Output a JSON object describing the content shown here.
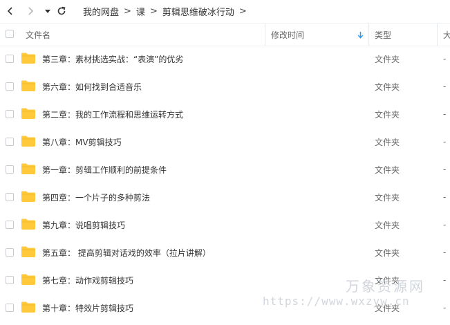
{
  "breadcrumb": {
    "items": [
      "我的网盘",
      "课",
      "剪辑思维破冰行动"
    ],
    "separator": ">"
  },
  "table": {
    "headers": {
      "name": "文件名",
      "modified": "修改时间",
      "type": "类型",
      "size": "大"
    },
    "sort_icon": "sort-arrow-down-icon",
    "rows": [
      {
        "name": "第三章：素材挑选实战：“表演”的优劣",
        "type": "文件夹",
        "size": "-"
      },
      {
        "name": "第六章：如何找到合适音乐",
        "type": "文件夹",
        "size": "-"
      },
      {
        "name": "第二章：我的工作流程和思维运转方式",
        "type": "文件夹",
        "size": "-"
      },
      {
        "name": "第八章：MV剪辑技巧",
        "type": "文件夹",
        "size": "-"
      },
      {
        "name": "第一章：剪辑工作顺利的前提条件",
        "type": "文件夹",
        "size": "-"
      },
      {
        "name": "第四章：一个片子的多种剪法",
        "type": "文件夹",
        "size": "-"
      },
      {
        "name": "第九章：说唱剪辑技巧",
        "type": "文件夹",
        "size": "-"
      },
      {
        "name": "第五章： 提高剪辑对话戏的效率（拉片讲解）",
        "type": "文件夹",
        "size": "-"
      },
      {
        "name": "第七章：动作戏剪辑技巧",
        "type": "文件夹",
        "size": "-"
      },
      {
        "name": "第十章：特效片剪辑技巧",
        "type": "文件夹",
        "size": "-"
      }
    ]
  },
  "watermark": {
    "text": "万象资源网",
    "url": "https://www.wxzyw.cn"
  },
  "colors": {
    "folder": "#ffc93b",
    "sort_icon": "#2a9bf0",
    "divider": "#eceff3"
  }
}
